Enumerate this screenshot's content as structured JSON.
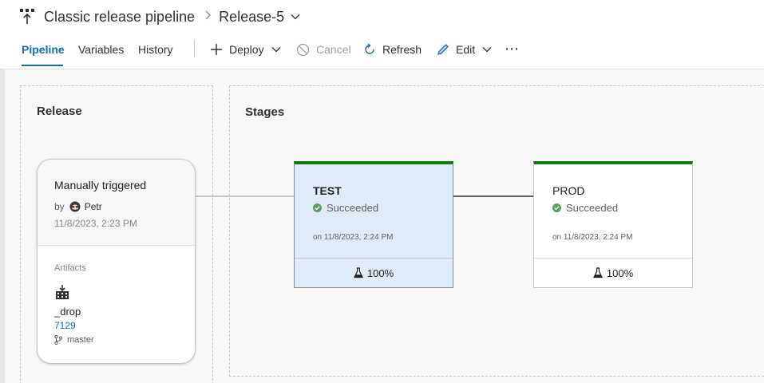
{
  "breadcrumb": {
    "pipeline": "Classic release pipeline",
    "separator": ">",
    "release": "Release-5"
  },
  "tabs": [
    {
      "label": "Pipeline",
      "active": true
    },
    {
      "label": "Variables",
      "active": false
    },
    {
      "label": "History",
      "active": false
    }
  ],
  "actions": {
    "deploy": "Deploy",
    "cancel": "Cancel",
    "refresh": "Refresh",
    "edit": "Edit",
    "more": "⋯"
  },
  "release_panel": {
    "title": "Release",
    "card": {
      "trigger": "Manually triggered",
      "by_label": "by",
      "user": "Petr",
      "date": "11/8/2023, 2:23 PM",
      "artifacts_label": "Artifacts",
      "artifact_name": "_drop",
      "build": "7129",
      "branch": "master"
    }
  },
  "stages_panel": {
    "title": "Stages",
    "stages": [
      {
        "name": "TEST",
        "status": "Succeeded",
        "date": "on 11/8/2023, 2:24 PM",
        "tests": "100%",
        "selected": true
      },
      {
        "name": "PROD",
        "status": "Succeeded",
        "date": "on 11/8/2023, 2:24 PM",
        "tests": "100%",
        "selected": false
      }
    ]
  },
  "colors": {
    "accent": "#0f6cbd",
    "success": "#107c10",
    "status_icon": "#57a15a",
    "selected_stage": "#deecf9"
  },
  "icons": [
    "pipeline-icon",
    "chevron-down-icon",
    "plus-icon",
    "cancel-icon",
    "refresh-icon",
    "pencil-icon",
    "avatar",
    "artifact-icon",
    "branch-icon",
    "check-circle-icon",
    "flask-icon"
  ]
}
